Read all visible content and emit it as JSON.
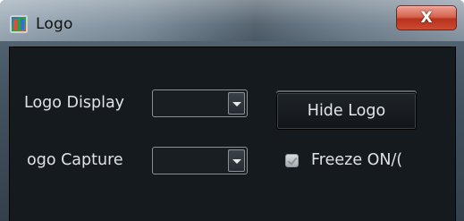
{
  "window": {
    "title": "Logo",
    "close_label": "X"
  },
  "form": {
    "logo_display_label": "Logo Display",
    "logo_capture_label": "ogo Capture",
    "logo_display_value": "",
    "logo_capture_value": "",
    "hide_logo_button": "Hide Logo",
    "freeze_label": "Freeze ON/(",
    "freeze_checked": false
  },
  "icons": {
    "app": "logo-app-icon",
    "close": "close-icon",
    "dropdown": "chevron-down-icon"
  },
  "colors": {
    "panel_background": "#151a1e",
    "text": "#dfe2e4",
    "close_button": "#c8452f"
  }
}
